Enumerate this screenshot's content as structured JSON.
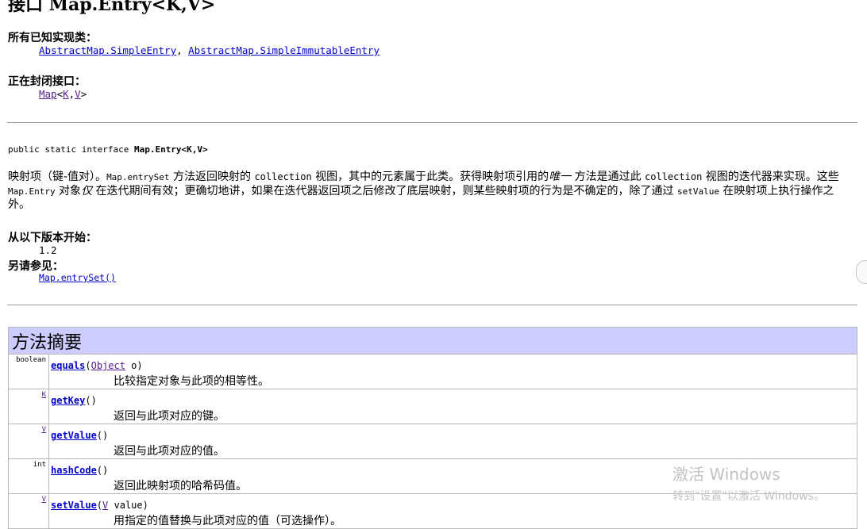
{
  "page_title": "接口 Map.Entry<K,V>",
  "known_impl": {
    "label": "所有已知实现类：",
    "classes": [
      "AbstractMap.SimpleEntry",
      "AbstractMap.SimpleImmutableEntry"
    ],
    "separator": ","
  },
  "enclosing": {
    "label": "正在封闭接口：",
    "map": "Map",
    "lt": "<",
    "k": "K",
    "comma": ",",
    "v": "V",
    "gt": ">"
  },
  "declaration": {
    "prefix": "public static interface ",
    "name": "Map.Entry<K,V>"
  },
  "description": {
    "p1": "映射项（键-值对）。",
    "c1": "Map.entrySet",
    "p2": " 方法返回映射的 ",
    "c2": "collection",
    "p3": " 视图，其中的元素属于此类。获得映射项引用的",
    "em1": "唯一",
    "p4": " 方法是通过此 ",
    "c3": "collection",
    "p5": " 视图的迭代器来实现。这些 ",
    "c4": "Map.Entry",
    "p6": " 对象",
    "em2": "仅",
    "p7": " 在迭代期间有效；更确切地讲，如果在迭代器返回项之后修改了底层映射，则某些映射项的行为是不确定的，除了通过 ",
    "c5": "setValue",
    "p8": " 在映射项上执行操作之外。"
  },
  "since": {
    "label": "从以下版本开始：",
    "value": "1.2"
  },
  "see_also": {
    "label": "另请参见：",
    "link": "Map.entrySet()"
  },
  "method_summary": {
    "heading": "方法摘要",
    "rows": [
      {
        "type": "boolean",
        "name": "equals",
        "open": "(",
        "param_type": "Object",
        "param_rest": " o)",
        "desc": "比较指定对象与此项的相等性。"
      },
      {
        "type": "K",
        "name": "getKey",
        "open": "(",
        "param_type": "",
        "param_rest": ")",
        "desc": "返回与此项对应的键。"
      },
      {
        "type": "V",
        "name": "getValue",
        "open": "(",
        "param_type": "",
        "param_rest": ")",
        "desc": "返回与此项对应的值。"
      },
      {
        "type": "int",
        "name": "hashCode",
        "open": "(",
        "param_type": "",
        "param_rest": ")",
        "desc": "返回此映射项的哈希码值。"
      },
      {
        "type": "V",
        "name": "setValue",
        "open": "(",
        "param_type": "V",
        "param_rest": " value)",
        "desc": "用指定的值替换与此项对应的值（可选操作）。"
      }
    ]
  },
  "watermark": {
    "line1": "激活 Windows",
    "line2": "转到\"设置\"以激活 Windows。"
  }
}
